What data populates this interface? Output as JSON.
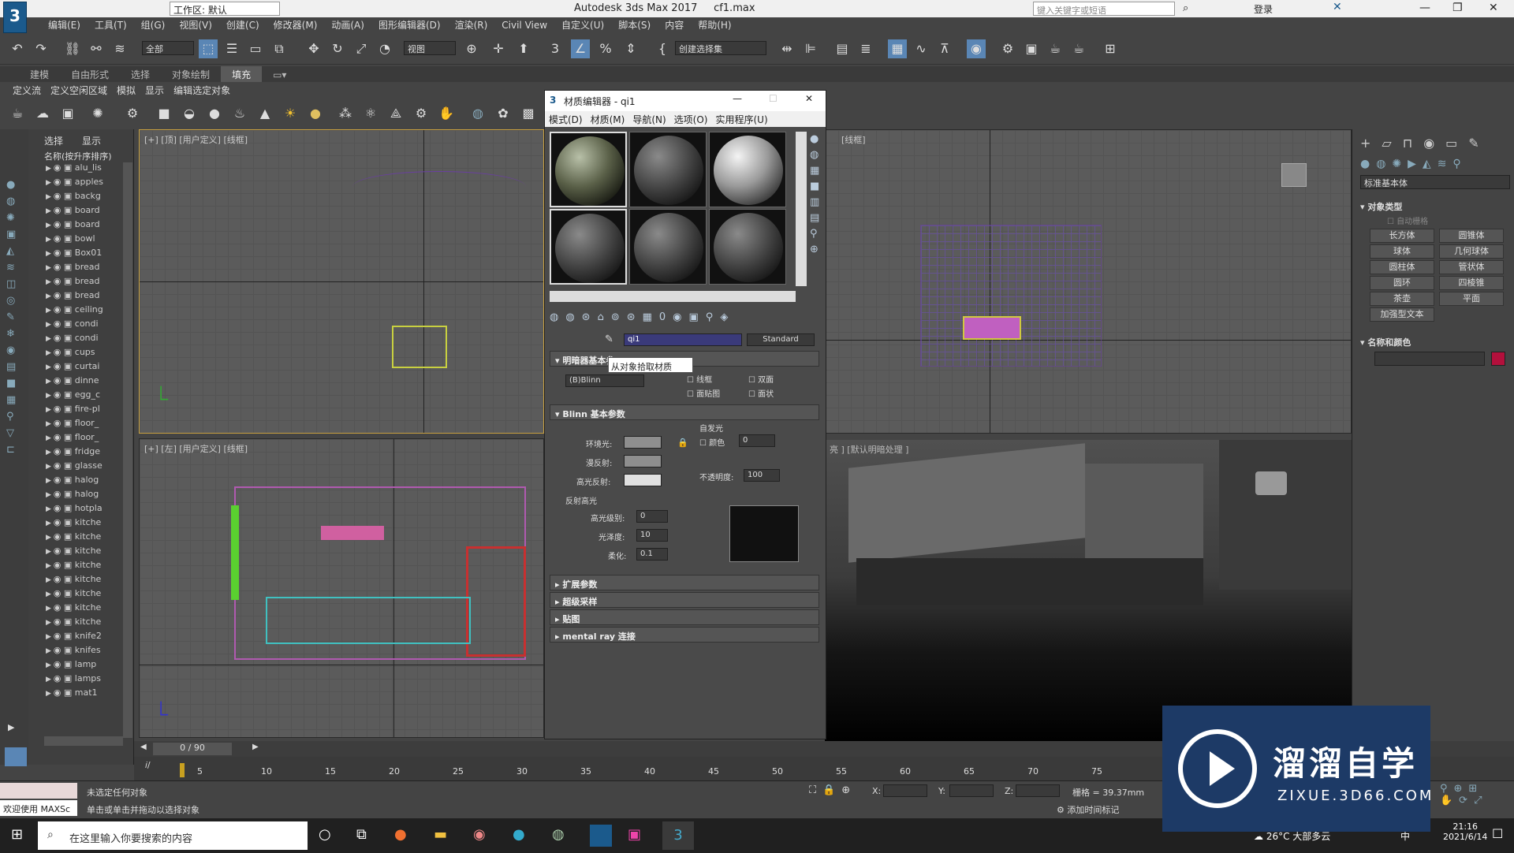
{
  "title": {
    "app": "Autodesk 3ds Max 2017",
    "file": "cf1.max",
    "workspace": "工作区: 默认",
    "search_placeholder": "键入关键字或短语",
    "login": "登录"
  },
  "logo": "3",
  "menus": [
    "编辑(E)",
    "工具(T)",
    "组(G)",
    "视图(V)",
    "创建(C)",
    "修改器(M)",
    "动画(A)",
    "图形编辑器(D)",
    "渲染(R)",
    "Civil View",
    "自定义(U)",
    "脚本(S)",
    "内容",
    "帮助(H)"
  ],
  "toolbar": {
    "filter": "全部",
    "view": "视图",
    "selection_set": "创建选择集"
  },
  "ribbon_tabs": [
    "建模",
    "自由形式",
    "选择",
    "对象绘制",
    "填充"
  ],
  "ribbon_sub": [
    "定义流",
    "定义空闲区域",
    "模拟",
    "显示",
    "编辑选定对象"
  ],
  "explorer": {
    "tabs": [
      "选择",
      "显示"
    ],
    "header": "名称(按升序排序)",
    "items": [
      "alu_lis",
      "apples",
      "backg",
      "board",
      "board",
      "bowl",
      "Box01",
      "bread",
      "bread",
      "bread",
      "ceiling",
      "condi",
      "condi",
      "cups",
      "curtai",
      "dinne",
      "egg_c",
      "fire-pl",
      "floor_",
      "floor_",
      "fridge",
      "glasse",
      "halog",
      "halog",
      "hotpla",
      "kitche",
      "kitche",
      "kitche",
      "kitche",
      "kitche",
      "kitche",
      "kitche",
      "kitche",
      "knife2",
      "knifes",
      "lamp",
      "lamps",
      "mat1"
    ]
  },
  "viewports": {
    "top": "[+] [顶] [用户定义] [线框]",
    "left": "[+] [左] [用户定义] [线框]",
    "right_top": "[线框]",
    "persp": "亮 ] [默认明暗处理 ]"
  },
  "material_editor": {
    "title": "材质编辑器 - qi1",
    "menus": [
      "模式(D)",
      "材质(M)",
      "导航(N)",
      "选项(O)",
      "实用程序(U)"
    ],
    "material_name": "qi1",
    "material_type": "Standard",
    "tooltip": "从对象拾取材质",
    "shader_rollout": "明暗器基本参",
    "shader": "(B)Blinn",
    "checks": [
      "线框",
      "双面",
      "面贴图",
      "面状"
    ],
    "blinn_rollout": "Blinn 基本参数",
    "self_illum": "自发光",
    "color_label": "颜色",
    "self_illum_value": "0",
    "ambient": "环境光:",
    "diffuse": "漫反射:",
    "specular": "高光反射:",
    "opacity_label": "不透明度:",
    "opacity": "100",
    "highlights": "反射高光",
    "spec_level_label": "高光级别:",
    "spec_level": "0",
    "gloss_label": "光泽度:",
    "gloss": "10",
    "soften_label": "柔化:",
    "soften": "0.1",
    "rollouts": [
      "扩展参数",
      "超级采样",
      "贴图",
      "mental ray 连接"
    ]
  },
  "command_panel": {
    "category": "标准基本体",
    "object_type": "对象类型",
    "autogrid": "自动栅格",
    "buttons": [
      "长方体",
      "圆锥体",
      "球体",
      "几何球体",
      "圆柱体",
      "管状体",
      "圆环",
      "四棱锥",
      "茶壶",
      "平面",
      "加强型文本"
    ],
    "name_color": "名称和颜色",
    "object_color": "#b3103c"
  },
  "timeline": {
    "frame": "0 / 90",
    "ticks": [
      "5",
      "10",
      "15",
      "20",
      "25",
      "30",
      "35",
      "40",
      "45",
      "50",
      "55",
      "60",
      "65",
      "70",
      "75"
    ]
  },
  "status": {
    "welcome": "欢迎使用 MAXSc",
    "none_selected": "未选定任何对象",
    "hint": "单击或单击并拖动以选择对象",
    "x": "X:",
    "y": "Y:",
    "z": "Z:",
    "grid": "栅格 = 39.37mm",
    "add_tag": "添加时间标记"
  },
  "taskbar": {
    "search": "在这里输入你要搜索的内容",
    "weather": "26°C 大部多云",
    "ime": "中",
    "time": "21:16",
    "date": "2021/6/14"
  },
  "watermark": {
    "brand": "溜溜自学",
    "url": "ZIXUE.3D66.COM"
  }
}
